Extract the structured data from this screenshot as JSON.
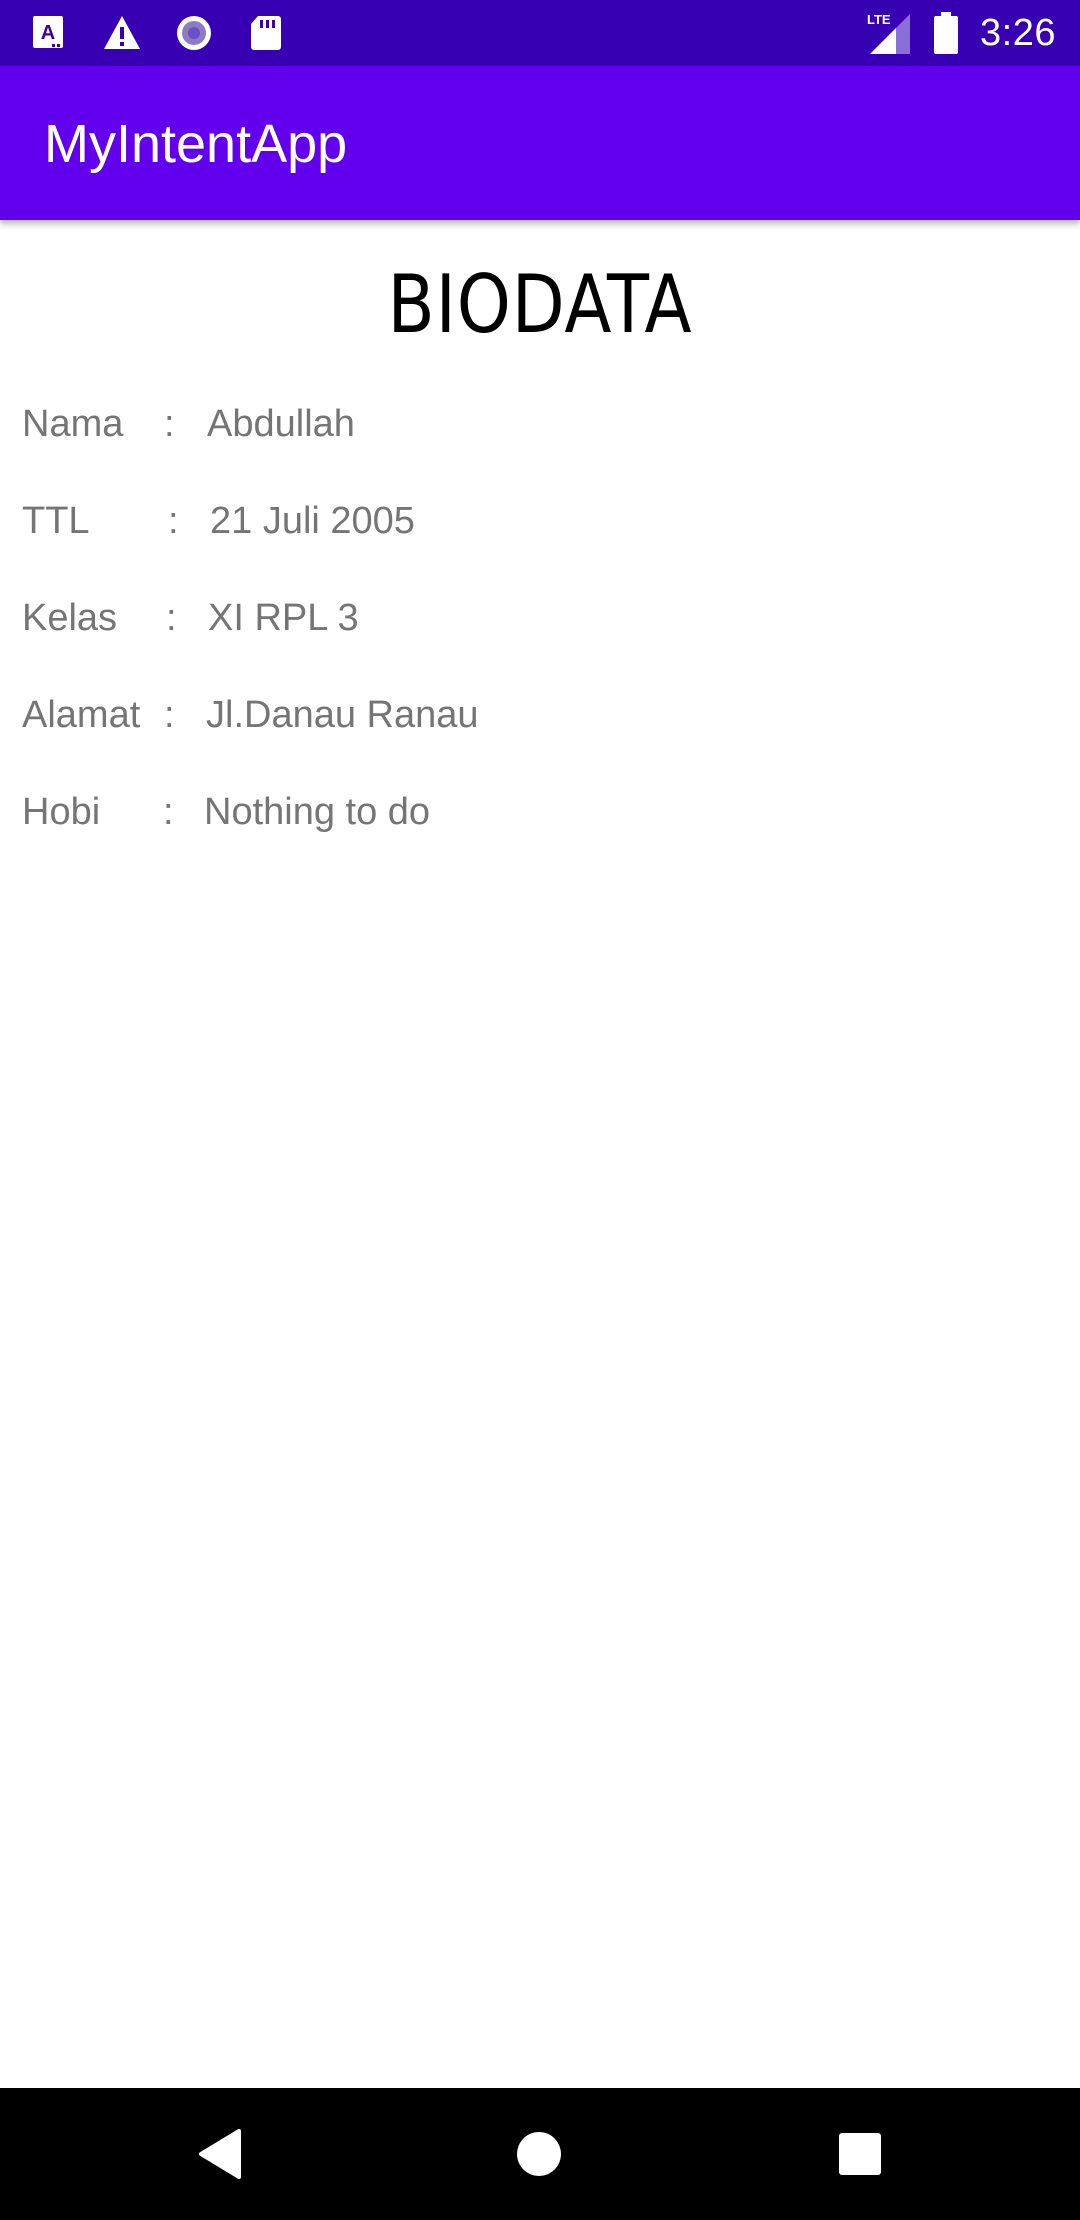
{
  "status_bar": {
    "time": "3:26",
    "network": "LTE",
    "left_icons": [
      "accessibility-a-icon",
      "warning-icon",
      "record-icon",
      "sd-card-icon"
    ],
    "right_icons": [
      "lte-signal-icon",
      "battery-icon"
    ],
    "color": "#3700b3"
  },
  "app_bar": {
    "title": "MyIntentApp",
    "color": "#6200ee"
  },
  "biodata": {
    "heading": "BIODATA",
    "rows": [
      {
        "label": "Nama",
        "colon": ":",
        "value": "Abdullah"
      },
      {
        "label": "TTL",
        "colon": ":",
        "value": "21 Juli 2005"
      },
      {
        "label": "Kelas",
        "colon": ":",
        "value": "XI RPL 3"
      },
      {
        "label": "Alamat",
        "colon": ":",
        "value": "Jl.Danau Ranau"
      },
      {
        "label": "Hobi",
        "colon": ":",
        "value": "Nothing to do"
      }
    ]
  },
  "nav_bar": {
    "buttons": [
      "back-icon",
      "home-icon",
      "recents-icon"
    ]
  }
}
